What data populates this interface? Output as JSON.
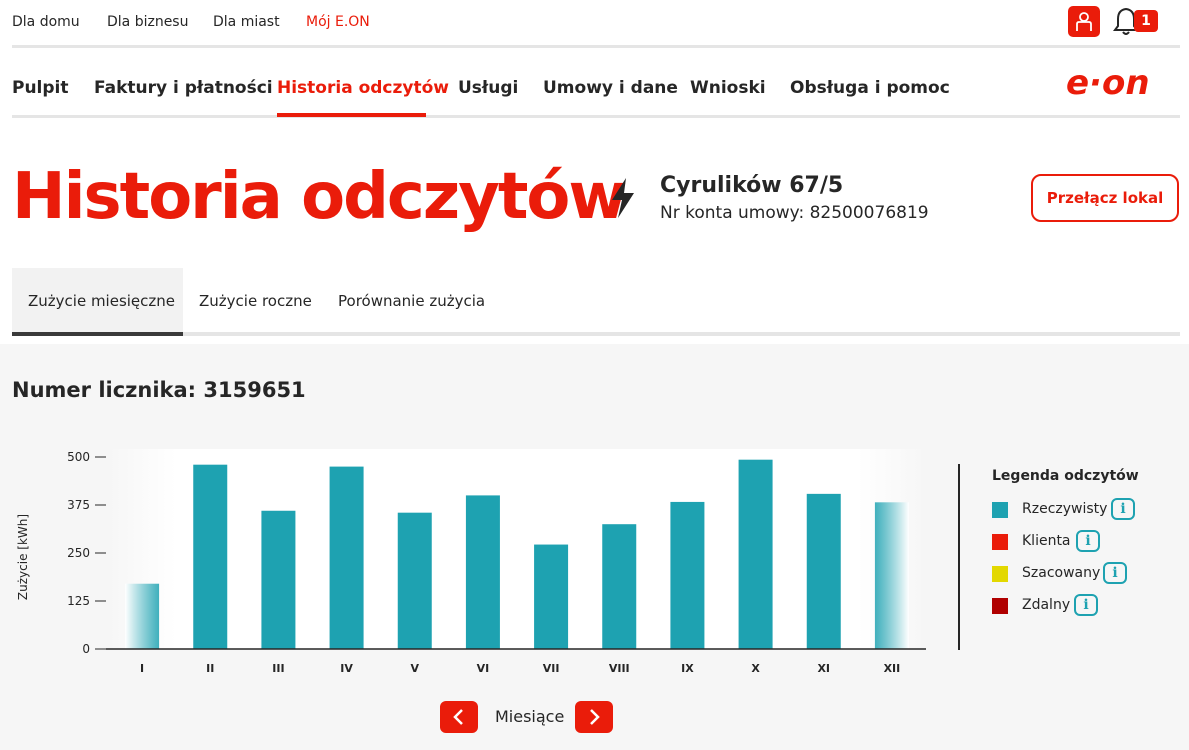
{
  "top_nav": {
    "items": [
      "Dla domu",
      "Dla biznesu",
      "Dla miast",
      "Mój E.ON"
    ],
    "notification_count": "1"
  },
  "main_nav": {
    "items": [
      "Pulpit",
      "Faktury i płatności",
      "Historia odczytów",
      "Usługi",
      "Umowy i dane",
      "Wnioski",
      "Obsługa i pomoc"
    ],
    "active": "Historia odczytów",
    "logo_text": "e·on"
  },
  "header": {
    "title": "Historia odczytów",
    "address": "Cyrulików 67/5",
    "account": "Nr konta umowy: 82500076819",
    "switch_button": "Przełącz lokal"
  },
  "tabs": [
    "Zużycie miesięczne",
    "Zużycie roczne",
    "Porównanie zużycia"
  ],
  "meter": "Numer licznika: 3159651",
  "colors": {
    "accent": "#ea1c0a",
    "bar": "#1ea2b1",
    "legend_klienta": "#ea1c0a",
    "legend_szacowany": "#e3d800",
    "legend_zdalny": "#b00000"
  },
  "chart_data": {
    "type": "bar",
    "categories": [
      "I",
      "II",
      "III",
      "IV",
      "V",
      "VI",
      "VII",
      "VIII",
      "IX",
      "X",
      "XI",
      "XII"
    ],
    "values": [
      170,
      480,
      360,
      475,
      355,
      400,
      272,
      325,
      383,
      493,
      404,
      382
    ],
    "ylabel": "Zużycie [kWh]",
    "xlabel": "Miesiące",
    "yticks": [
      0,
      125,
      250,
      375,
      500
    ],
    "ylim": [
      0,
      500
    ],
    "grid": false
  },
  "legend": {
    "title": "Legenda odczytów",
    "items": [
      "Rzeczywisty",
      "Klienta",
      "Szacowany",
      "Zdalny"
    ],
    "info_icon": "i"
  }
}
